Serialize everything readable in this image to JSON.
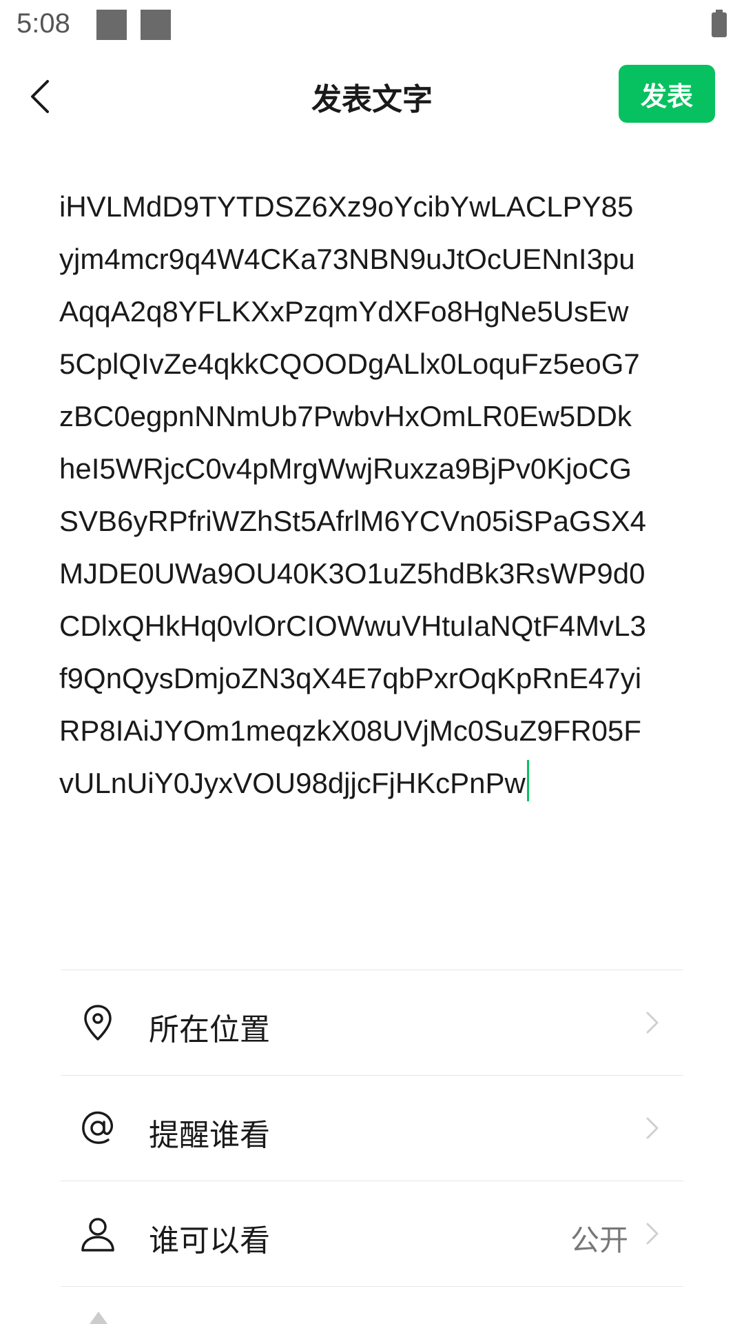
{
  "status_bar": {
    "time": "5:08"
  },
  "header": {
    "title": "发表文字",
    "publish_label": "发表"
  },
  "post": {
    "text": "iHVLMdD9TYTDSZ6Xz9oYcibYwLACLPY85\nyjm4mcr9q4W4CKa73NBN9uJtOcUENnI3pu\nAqqA2q8YFLKXxPzqmYdXFo8HgNe5UsEw\n5CplQIvZe4qkkCQOODgALlx0LoquFz5eoG7\nzBC0egpnNNmUb7PwbvHxOmLR0Ew5DDk\nheI5WRjcC0v4pMrgWwjRuxza9BjPv0KjoCG\nSVB6yRPfriWZhSt5AfrlM6YCVn05iSPaGSX4\nMJDE0UWa9OU40K3O1uZ5hdBk3RsWP9d0\nCDlxQHkHq0vlOrCIOWwuVHtuIaNQtF4MvL3\nf9QnQysDmjoZN3qX4E7qbPxrOqKpRnE47yi\nRP8IAiJYOm1meqzkX08UVjMc0SuZ9FR05F\nvULnUiY0JyxVOU98djjcFjHKcPnPw"
  },
  "options": {
    "location": {
      "label": "所在位置",
      "icon": "location-pin-icon"
    },
    "mention": {
      "label": "提醒谁看",
      "icon": "at-icon"
    },
    "visibility": {
      "label": "谁可以看",
      "value": "公开",
      "icon": "user-icon"
    }
  },
  "colors": {
    "accent": "#07c160",
    "text": "#1a1a1a",
    "secondary_text": "#777777",
    "divider": "#e6e6e6"
  }
}
